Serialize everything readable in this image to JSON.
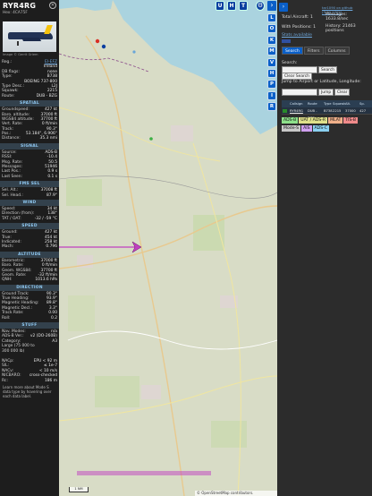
{
  "info": {
    "callsign": "RYR4RG",
    "hex_label": "Hex:",
    "hex": "4CA75F",
    "photo_credit": "Image © Gerrit Griem",
    "reg_rows": [
      {
        "k": "Reg.:",
        "v": "EI-EFZ",
        "link": true
      },
      {
        "k": "",
        "v": "Ireland",
        "link": false
      },
      {
        "k": "DB flags:",
        "v": "none",
        "link": false
      },
      {
        "k": "Type:",
        "v": "B738",
        "link": false
      },
      {
        "k": "",
        "v": "BOEING 737-800",
        "link": false
      },
      {
        "k": "Type Desc.:",
        "v": "L2J",
        "link": false
      },
      {
        "k": "Squawk:",
        "v": "2215",
        "link": false
      },
      {
        "k": "Route:",
        "v": "DUB - BZG",
        "link": false
      }
    ],
    "sections": [
      {
        "title": "SPATIAL",
        "rows": [
          {
            "k": "Groundspeed:",
            "v": "427 kt"
          },
          {
            "k": "Baro. altitude:",
            "v": "37000 ft"
          },
          {
            "k": "WGS84 altitude:",
            "v": "37700 ft"
          },
          {
            "k": "Vert. Rate:",
            "v": "0 ft/min"
          },
          {
            "k": "Track:",
            "v": "90.3°"
          },
          {
            "k": "Pos.:",
            "v": "53.184°, 6.906°"
          },
          {
            "k": "Distance:",
            "v": "35.3 nmi"
          }
        ]
      },
      {
        "title": "SIGNAL",
        "rows": [
          {
            "k": "Source:",
            "v": "ADS-B"
          },
          {
            "k": "RSSI:",
            "v": "-10.4"
          },
          {
            "k": "Msg. Rate:",
            "v": "50.5"
          },
          {
            "k": "Messages:",
            "v": "51946"
          },
          {
            "k": "Last Pos.:",
            "v": "0.9 s"
          },
          {
            "k": "Last Seen:",
            "v": "0.1 s"
          }
        ]
      },
      {
        "title": "FMS SEL",
        "rows": [
          {
            "k": "Sel. Alt.:",
            "v": "37008 ft"
          },
          {
            "k": "Sel. Head.:",
            "v": "87.9°"
          }
        ]
      },
      {
        "title": "WIND",
        "rows": [
          {
            "k": "Speed:",
            "v": "34 kt"
          },
          {
            "k": "Direction (from):",
            "v": "138°"
          },
          {
            "k": "TAT / OAT:",
            "v": "-32 / -59 °C"
          }
        ]
      },
      {
        "title": "SPEED",
        "rows": [
          {
            "k": "Ground:",
            "v": "427 kt"
          },
          {
            "k": "True:",
            "v": "454 kt"
          },
          {
            "k": "Indicated:",
            "v": "258 kt"
          },
          {
            "k": "Mach:",
            "v": "0.796"
          }
        ]
      },
      {
        "title": "ALTITUDE",
        "rows": [
          {
            "k": "Barometric:",
            "v": "37000 ft"
          },
          {
            "k": "Baro. Rate:",
            "v": "0 ft/min"
          },
          {
            "k": "Geom. WGS84:",
            "v": "37700 ft"
          },
          {
            "k": "Geom. Rate:",
            "v": "-32 ft/min"
          },
          {
            "k": "QNH:",
            "v": "1013.6 hPa"
          }
        ]
      },
      {
        "title": "DIRECTION",
        "rows": [
          {
            "k": "Ground Track:",
            "v": "90.3°"
          },
          {
            "k": "True Heading:",
            "v": "93.9°"
          },
          {
            "k": "Magnetic Heading:",
            "v": "89.8°"
          },
          {
            "k": "Magnetic Decl.:",
            "v": "3.3°"
          },
          {
            "k": "Track Rate:",
            "v": "0.00"
          },
          {
            "k": "Roll:",
            "v": "0.2"
          }
        ]
      },
      {
        "title": "STUFF",
        "rows": [
          {
            "k": "Nav. Modes:",
            "v": "n/a"
          },
          {
            "k": "ADS-B Ver.:",
            "v": "v2 (DO-260B)"
          },
          {
            "k": "Category:",
            "v": "A3"
          },
          {
            "k": "Large (75 000 to",
            "v": ""
          },
          {
            "k": "300 000 lb)",
            "v": ""
          }
        ]
      },
      {
        "title": "",
        "rows": [
          {
            "k": "NACp:",
            "v": "EPU < 92 m"
          },
          {
            "k": "SIL:",
            "v": "≤ 1e-7"
          },
          {
            "k": "NACv:",
            "v": "< 10 m/s"
          },
          {
            "k": "NICBARO:",
            "v": "cross-checked"
          },
          {
            "k": "Rc:",
            "v": "186 m"
          }
        ]
      }
    ],
    "note": "Learn more about Mode S data type by hovering over each data label."
  },
  "map": {
    "top_buttons": [
      "U",
      "H",
      "T"
    ],
    "side_buttons": [
      "L",
      "O",
      "K",
      "M",
      "V",
      "H",
      "P",
      "I",
      "R"
    ],
    "arrow_label": "›",
    "scale_label": "1 NM",
    "attribution": "© OpenStreetMap contributors.",
    "zoom_in": "+",
    "zoom_out": "−"
  },
  "right": {
    "version": "tar1090 on github (3.14.1702)",
    "total_aircraft_label": "Total Aircraft: 1",
    "with_positions_label": "With Positions: 1",
    "messages_label": "Messages:",
    "messages_value": "1633.8/sec",
    "history_label": "History: 21463",
    "history_value": "positions",
    "stats_label": "Stats available",
    "tabs": [
      "Search",
      "Filters",
      "Columns"
    ],
    "search_label": "Search:",
    "search_button": "Search",
    "clear_search_button": "Clear Search",
    "jump_label": "Jump to Airport or Latitude, Longitude:",
    "jump_button": "Jump",
    "clear_button": "Clear",
    "table_headers": [
      "",
      "Callsign",
      "Route",
      "Type",
      "Squawk",
      "Alt.",
      "Sp."
    ],
    "table_row": [
      "",
      "RYR4RG",
      "DUB - BZG",
      "B738",
      "2215",
      "37000",
      "427"
    ],
    "legend": [
      {
        "label": "ADS-B",
        "color": "#8de08a"
      },
      {
        "label": "UAT / ADS-R",
        "color": "#dfe08a"
      },
      {
        "label": "MLAT",
        "color": "#f0b08a"
      },
      {
        "label": "TIS-B",
        "color": "#f08a8a"
      },
      {
        "label": "Mode-S",
        "color": "#c8c8c8"
      },
      {
        "label": "AIS",
        "color": "#d0a0f0"
      },
      {
        "label": "ADS-C",
        "color": "#8ad0f0"
      }
    ]
  }
}
